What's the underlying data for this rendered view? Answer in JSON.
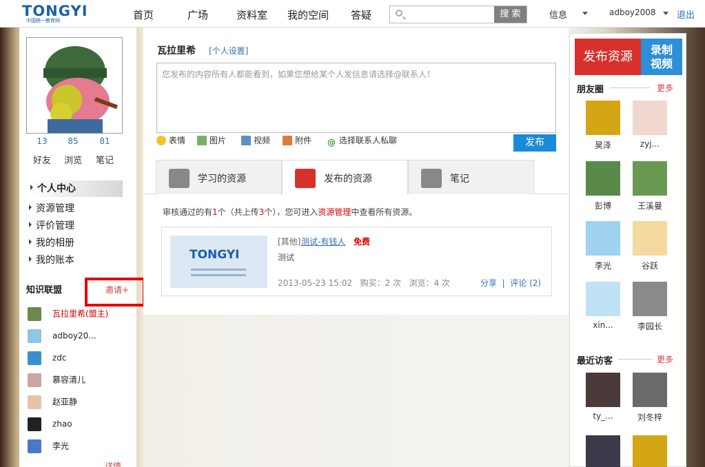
{
  "header": {
    "logo_text": "TONGYI",
    "logo_sub": "中国统一教育网",
    "nav": [
      "首页",
      "广场",
      "资料室",
      "我的空间",
      "答疑"
    ],
    "search_placeholder": "",
    "search_button": "搜 索",
    "messages": "信息",
    "username": "adboy2008",
    "logout": "退出"
  },
  "profile": {
    "stats": [
      {
        "value": "13",
        "label": "好友"
      },
      {
        "value": "85",
        "label": "浏览"
      },
      {
        "value": "81",
        "label": "笔记"
      }
    ],
    "menu": [
      "个人中心",
      "资源管理",
      "评价管理",
      "我的相册",
      "我的账本"
    ],
    "alliance_title": "知识联盟",
    "invite": "邀请+",
    "members": [
      "瓦拉里希(盟主)",
      "adboy20...",
      "zdc",
      "慕容清儿",
      "赵亚静",
      "zhao",
      "李光"
    ],
    "more": "详情"
  },
  "main": {
    "username": "瓦拉里希",
    "settings": "[个人设置]",
    "compose_placeholder": "您发布的内容所有人都能看到，如果您想给某个人发信息请选择@联系人！",
    "tools": [
      "表情",
      "图片",
      "视频",
      "附件",
      "选择联系人私聊"
    ],
    "publish": "发布",
    "tabs": [
      "学习的资源",
      "发布的资源",
      "笔记"
    ],
    "notice_1": "审核通过的有",
    "notice_count": "1",
    "notice_2": "个（共上传",
    "notice_total": "3",
    "notice_3": "个），您可进入",
    "notice_link": "资源管理",
    "notice_4": "中查看所有资源。",
    "resource": {
      "thumb_text": "TONGYI",
      "category": "[其他]",
      "title": "测试-有钱人",
      "price": "免费",
      "desc": "测试",
      "meta": "2013-05-23 15:02   购买：2 次   浏览：4 次",
      "actions": "分享  |  评论 (2)"
    }
  },
  "sidebar_right": {
    "publish_resource": "发布资源",
    "record_video": "录制视频",
    "friends_title": "朋友圈",
    "friends_more": "更多",
    "friends": [
      "昊泽",
      "zyj...",
      "彭博",
      "王溪曼",
      "李光",
      "谷跃",
      "xin...",
      "李园长"
    ],
    "visitors_title": "最近访客",
    "visitors_more": "更多",
    "visitors": [
      "ty_...",
      "刘冬梓"
    ]
  },
  "colors": {
    "brand_blue": "#1d5fa8",
    "link_blue": "#2f71b5",
    "publish_blue": "#1b8ad8",
    "red": "#d8302b",
    "highlight_red": "#e60000"
  }
}
